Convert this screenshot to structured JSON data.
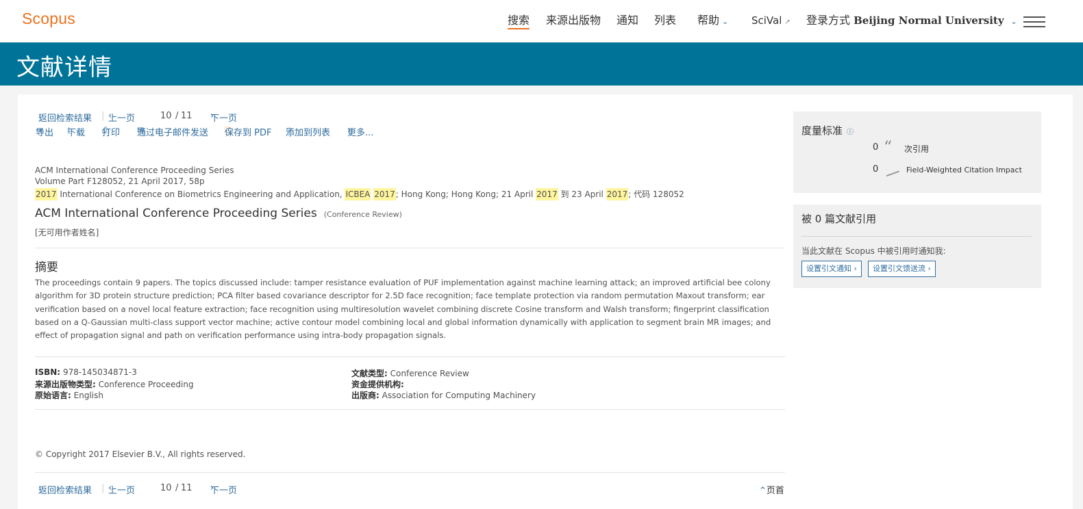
{
  "header": {
    "logo": "Scopus",
    "nav": {
      "search": "搜索",
      "sources": "来源出版物",
      "alerts": "通知",
      "lists": "列表",
      "help": "帮助",
      "scival": "SciVal",
      "login_prefix": "登录方式",
      "institution": "Beijing Normal University"
    }
  },
  "banner": {
    "title": "文献详情"
  },
  "pager": {
    "back": "返回检索结果",
    "prev": "上一页",
    "current": "10",
    "slash": "/",
    "total": "11",
    "next": "下一页"
  },
  "actions": {
    "export": "导出",
    "download": "下载",
    "print": "打印",
    "email": "通过电子邮件发送",
    "save_pdf": "保存到 PDF",
    "add_list": "添加到列表",
    "more": "更多..."
  },
  "document": {
    "series": "ACM International Conference Proceeding Series",
    "volume_line": "Volume Part F128052, 21 April 2017, 58p",
    "conference": {
      "year1": "2017",
      "name": "International Conference on Biometrics Engineering and Application,",
      "acronym": "ICBEA",
      "year2": "2017",
      "location_date": "; Hong Kong; Hong Kong; 21 April",
      "year3": "2017",
      "to": "到 23 April",
      "year4": "2017",
      "code": "; 代码 128052"
    },
    "title": "ACM International Conference Proceeding Series",
    "type_badge": "(Conference Review)",
    "authors": "[无可用作者姓名]",
    "abstract_heading": "摘要",
    "abstract": "The proceedings contain 9 papers. The topics discussed include: tamper resistance evaluation of PUF implementation against machine learning attack; an improved artificial bee colony algorithm for 3D protein structure prediction; PCA filter based covariance descriptor for 2.5D face recognition; face template protection via random permutation Maxout transform; ear verification based on a novel local feature extraction; face recognition using multiresolution wavelet combining discrete Cosine transform and Walsh transform; fingerprint classification based on a Q-Gaussian multi-class support vector machine; active contour model combining local and global information dynamically with application to segment brain MR images; and effect of propagation signal and path on verification performance using intra-body propagation signals.",
    "details": {
      "isbn_label": "ISBN:",
      "isbn": "978-145034871-3",
      "source_type_label": "来源出版物类型:",
      "source_type": "Conference Proceeding",
      "language_label": "原始语言:",
      "language": "English",
      "doc_type_label": "文献类型:",
      "doc_type": "Conference Review",
      "funding_label": "资金提供机构:",
      "funding": "",
      "publisher_label": "出版商:",
      "publisher": "Association for Computing Machinery"
    },
    "copyright": "© Copyright 2017 Elsevier B.V., All rights reserved."
  },
  "footer": {
    "page_top": "页首"
  },
  "metrics": {
    "heading": "度量标准",
    "citations_value": "0",
    "citations_label": "次引用",
    "fwci_value": "0",
    "fwci_label": "Field-Weighted Citation Impact"
  },
  "cited_by": {
    "heading": "被 0 篇文献引用",
    "notice": "当此文献在 Scopus 中被引用时通知我:",
    "alert_btn": "设置引文通知",
    "feed_btn": "设置引文馈送流"
  },
  "colors": {
    "brand": "#e9711c",
    "banner": "#007398",
    "link": "#2e6c9e",
    "highlight": "#fff59d"
  },
  "icons": [
    "chevron-down-icon",
    "external-link-icon",
    "menu-icon",
    "chevron-left-icon",
    "chevron-right-icon",
    "export-icon",
    "download-icon",
    "print-icon",
    "email-icon",
    "pdf-icon",
    "star-icon",
    "info-icon",
    "quote-icon",
    "fwci-icon",
    "chevron-up-icon"
  ]
}
